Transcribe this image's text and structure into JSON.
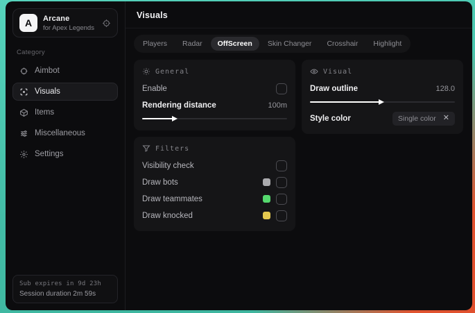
{
  "colors": {
    "backdrop_teal": "#43bda6",
    "backdrop_mint": "#56d3bc",
    "backdrop_red": "#e0532f",
    "window_bg": "#0c0c0e",
    "panel_bg": "#151517",
    "swatch_bots": "#aaaaae",
    "swatch_teammates": "#55d96e",
    "swatch_knocked": "#e4c84e"
  },
  "sidebar": {
    "brand": {
      "initial": "A",
      "title": "Arcane",
      "subtitle": "for Apex Legends"
    },
    "category_label": "Category",
    "items": [
      {
        "label": "Aimbot"
      },
      {
        "label": "Visuals"
      },
      {
        "label": "Items"
      },
      {
        "label": "Miscellaneous"
      },
      {
        "label": "Settings"
      }
    ],
    "footer": {
      "line1": "Sub expires in 9d 23h",
      "line2": "Session duration 2m 59s"
    }
  },
  "main": {
    "title": "Visuals",
    "tabs": [
      {
        "label": "Players"
      },
      {
        "label": "Radar"
      },
      {
        "label": "OffScreen"
      },
      {
        "label": "Skin Changer"
      },
      {
        "label": "Crosshair"
      },
      {
        "label": "Highlight"
      }
    ],
    "panels": {
      "general": {
        "title": "General",
        "enable_label": "Enable",
        "enable_checked": false,
        "distance_label": "Rendering distance",
        "distance_value": "100m",
        "distance_fill": "21%"
      },
      "filters": {
        "title": "Filters",
        "rows": [
          {
            "label": "Visibility check",
            "checked": false
          },
          {
            "label": "Draw bots",
            "swatch": "#aaaaae",
            "checked": false
          },
          {
            "label": "Draw teammates",
            "swatch": "#55d96e",
            "checked": false
          },
          {
            "label": "Draw knocked",
            "swatch": "#e4c84e",
            "checked": false
          }
        ]
      },
      "visual": {
        "title": "Visual",
        "outline_label": "Draw outline",
        "outline_value": "128.0",
        "outline_fill": "48%",
        "style_label": "Style color",
        "style_value": "Single color"
      }
    }
  }
}
